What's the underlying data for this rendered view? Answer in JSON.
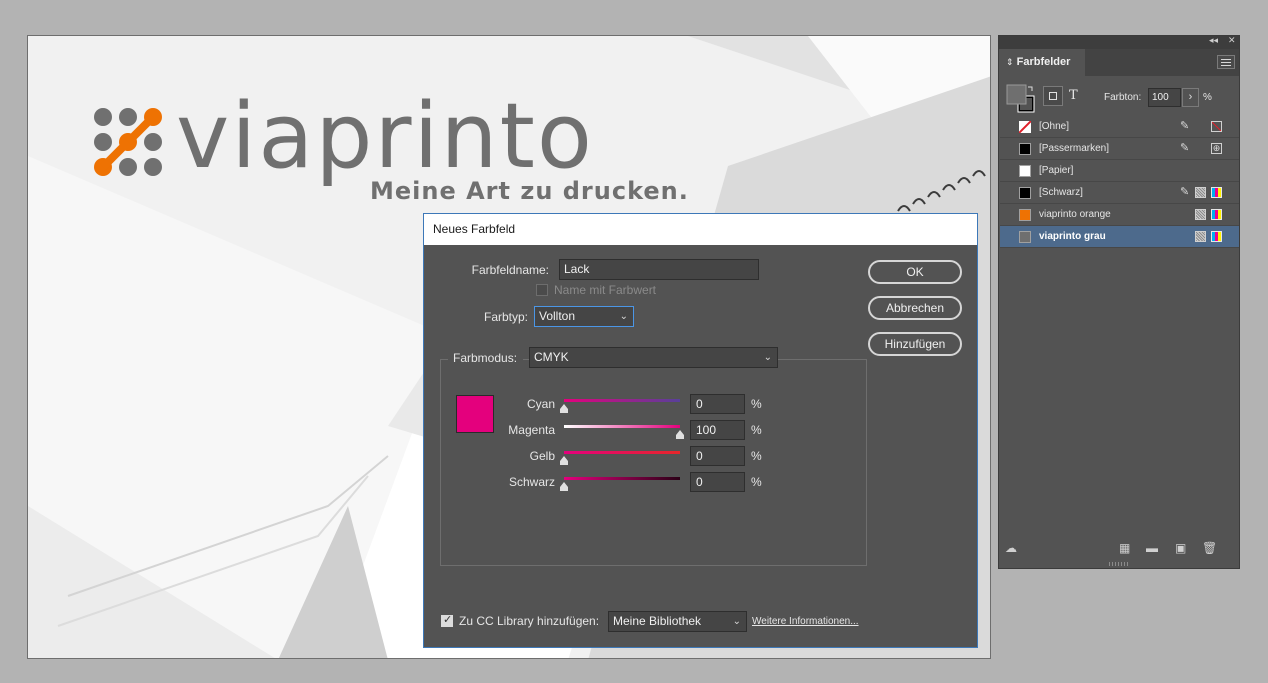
{
  "document": {
    "logo_text": "viaprinto",
    "tagline": "Meine Art zu drucken.",
    "brand_colors": {
      "orange": "#ee7203",
      "grey": "#707070"
    }
  },
  "dialog": {
    "title": "Neues Farbfeld",
    "name_label": "Farbfeldname:",
    "name_value": "Lack",
    "name_with_value_label": "Name mit Farbwert",
    "type_label": "Farbtyp:",
    "type_value": "Vollton",
    "mode_label": "Farbmodus:",
    "mode_value": "CMYK",
    "swatch_color": "#e4007d",
    "sliders": [
      {
        "label": "Cyan",
        "value": "0",
        "unit": "%"
      },
      {
        "label": "Magenta",
        "value": "100",
        "unit": "%"
      },
      {
        "label": "Gelb",
        "value": "0",
        "unit": "%"
      },
      {
        "label": "Schwarz",
        "value": "0",
        "unit": "%"
      }
    ],
    "buttons": {
      "ok": "OK",
      "cancel": "Abbrechen",
      "add": "Hinzufügen"
    },
    "cc_library_label": "Zu CC Library hinzufügen:",
    "cc_library_value": "Meine Bibliothek",
    "more_info_link": "Weitere Informationen..."
  },
  "panel": {
    "title": "Farbfelder",
    "tint_label": "Farbton:",
    "tint_value": "100",
    "tint_unit": "%",
    "text_toggle": "T",
    "swatches": [
      {
        "name": "[Ohne]",
        "color": "none"
      },
      {
        "name": "[Passermarken]",
        "color": "#000000"
      },
      {
        "name": "[Papier]",
        "color": "#ffffff"
      },
      {
        "name": "[Schwarz]",
        "color": "#000000"
      },
      {
        "name": "viaprinto orange",
        "color": "#ee7203"
      },
      {
        "name": "viaprinto grau",
        "color": "#6f6f6f"
      }
    ]
  }
}
